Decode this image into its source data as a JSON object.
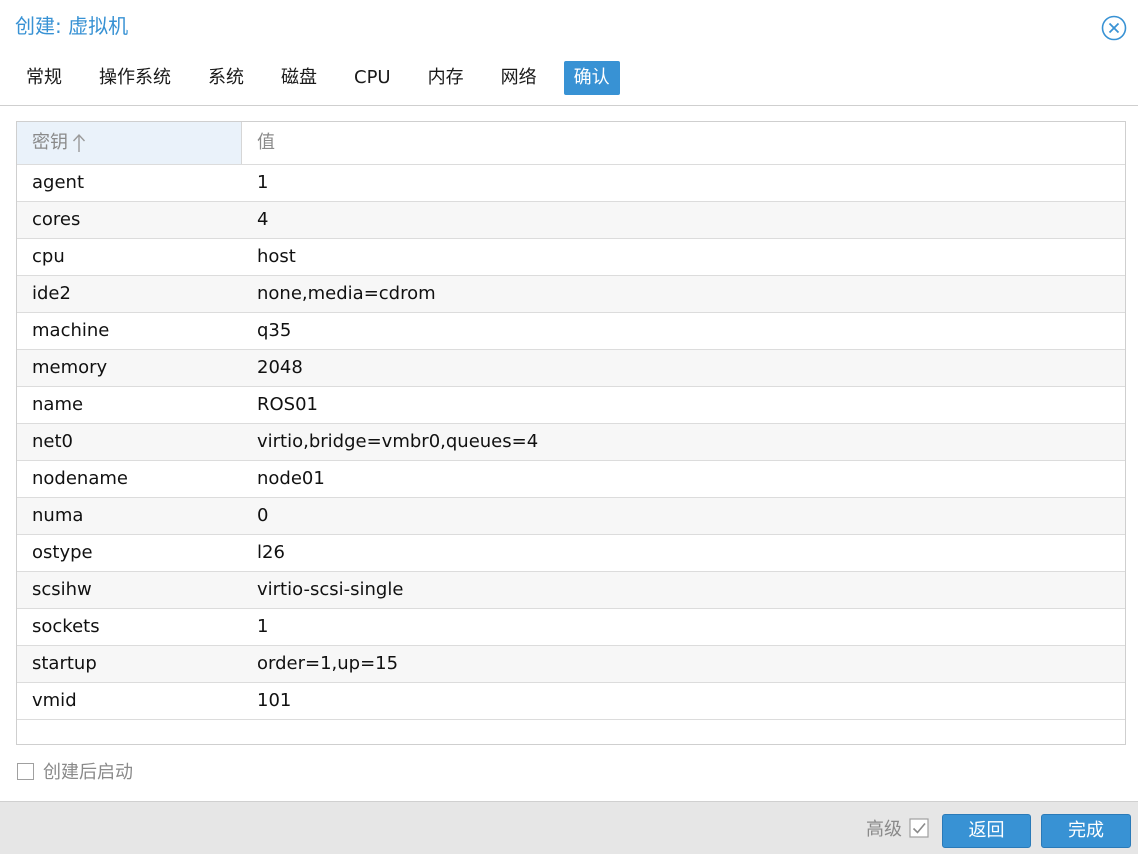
{
  "window": {
    "title": "创建: 虚拟机",
    "close_icon": "close-circle-icon"
  },
  "tabs": [
    {
      "label": "常规",
      "active": false
    },
    {
      "label": "操作系统",
      "active": false
    },
    {
      "label": "系统",
      "active": false
    },
    {
      "label": "磁盘",
      "active": false
    },
    {
      "label": "CPU",
      "active": false
    },
    {
      "label": "内存",
      "active": false
    },
    {
      "label": "网络",
      "active": false
    },
    {
      "label": "确认",
      "active": true
    }
  ],
  "grid": {
    "columns": {
      "key": "密钥",
      "value": "值"
    },
    "sort": {
      "column": "key",
      "direction": "ascending",
      "icon": "arrow-up-icon"
    },
    "rows": [
      {
        "key": "agent",
        "value": "1"
      },
      {
        "key": "cores",
        "value": "4"
      },
      {
        "key": "cpu",
        "value": "host"
      },
      {
        "key": "ide2",
        "value": "none,media=cdrom"
      },
      {
        "key": "machine",
        "value": "q35"
      },
      {
        "key": "memory",
        "value": "2048"
      },
      {
        "key": "name",
        "value": "ROS01"
      },
      {
        "key": "net0",
        "value": "virtio,bridge=vmbr0,queues=4"
      },
      {
        "key": "nodename",
        "value": "node01"
      },
      {
        "key": "numa",
        "value": "0"
      },
      {
        "key": "ostype",
        "value": "l26"
      },
      {
        "key": "scsihw",
        "value": "virtio-scsi-single"
      },
      {
        "key": "sockets",
        "value": "1"
      },
      {
        "key": "startup",
        "value": "order=1,up=15"
      },
      {
        "key": "vmid",
        "value": "101"
      }
    ]
  },
  "start_after_create": {
    "label": "创建后启动",
    "checked": false
  },
  "footer": {
    "advanced_label": "高级",
    "advanced_checked": true,
    "back_label": "返回",
    "finish_label": "完成"
  },
  "colors": {
    "accent": "#3892d4",
    "footer_bg": "#e6e6e6",
    "header_sort_bg": "#eaf2fa"
  }
}
